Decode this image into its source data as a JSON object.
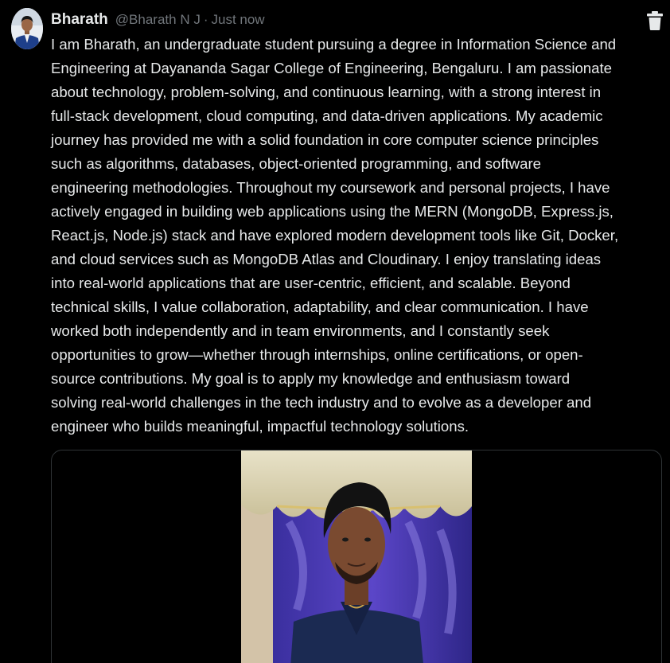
{
  "post": {
    "author_name": "Bharath",
    "author_handle": "@Bharath N J",
    "separator": "·",
    "timestamp": "Just now",
    "delete_icon": "trash-icon",
    "avatar_icon": "user-avatar",
    "text": "I am Bharath, an undergraduate student pursuing a degree in Information Science and\nEngineering at Dayananda Sagar College of Engineering, Bengaluru. I am passionate\nabout technology, problem-solving, and continuous learning, with a strong interest in\nfull-stack development, cloud computing, and data-driven applications. My academic\njourney has provided me with a solid foundation in core computer science principles\nsuch as algorithms, databases, object-oriented programming, and software\nengineering methodologies. Throughout my coursework and personal projects, I have\nactively engaged in building web applications using the MERN (MongoDB, Express.js,\nReact.js, Node.js) stack and have explored modern development tools like Git, Docker,\nand cloud services such as MongoDB Atlas and Cloudinary. I enjoy translating ideas\ninto real-world applications that are user-centric, efficient, and scalable. Beyond\ntechnical skills, I value collaboration, adaptability, and clear communication. I have\nworked both independently and in team environments, and I constantly seek\nopportunities to grow—whether through internships, online certifications, or open-\nsource contributions. My goal is to apply my knowledge and enthusiasm toward\nsolving real-world challenges in the tech industry and to evolve as a developer and\nengineer who builds meaningful, impactful technology solutions."
  },
  "colors": {
    "background": "#000000",
    "text": "#e7e9ea",
    "muted": "#71767b",
    "border": "#2f3336"
  }
}
